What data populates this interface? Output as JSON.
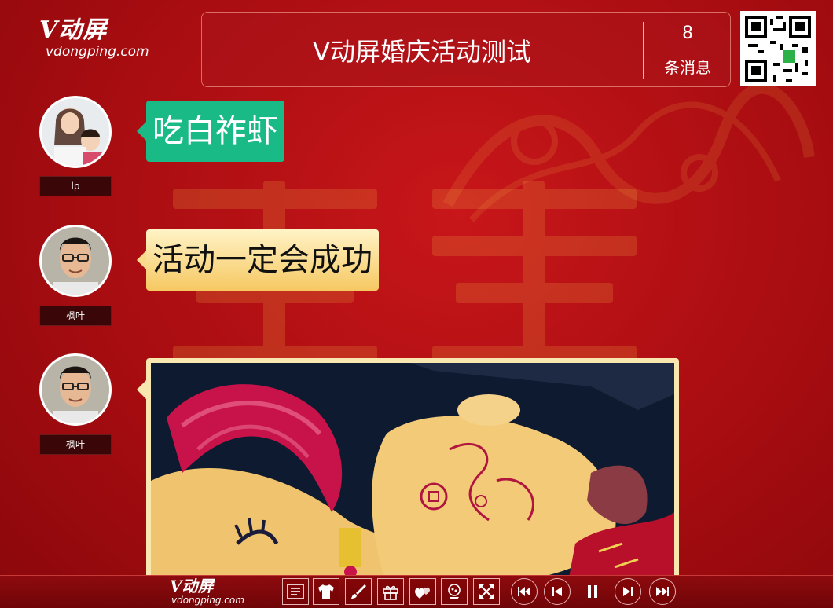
{
  "header": {
    "logo_brand": "V动屏",
    "logo_domain": "vdongping.com",
    "title": "V动屏婚庆活动测试",
    "message_count": "8",
    "message_count_label": "条消息"
  },
  "messages": [
    {
      "name": "lp",
      "text": "吃白祚虾",
      "bubble_color": "#1aba86"
    },
    {
      "name": "枫叶",
      "text": "活动一定会成功",
      "bubble_color": "#f6c862"
    },
    {
      "name": "枫叶",
      "type": "image"
    }
  ],
  "footer": {
    "logo_brand": "V动屏",
    "logo_domain": "vdongping.com",
    "tools": [
      "list-icon",
      "shirt-icon",
      "brush-icon",
      "gift-icon",
      "hearts-icon",
      "lottery-icon",
      "fullscreen-icon"
    ],
    "playback": [
      "skip-first-icon",
      "previous-icon",
      "pause-icon",
      "next-icon",
      "skip-last-icon"
    ]
  },
  "colors": {
    "background": "#b0100f",
    "accent_green": "#1aba86",
    "accent_yellow": "#f6c862"
  }
}
